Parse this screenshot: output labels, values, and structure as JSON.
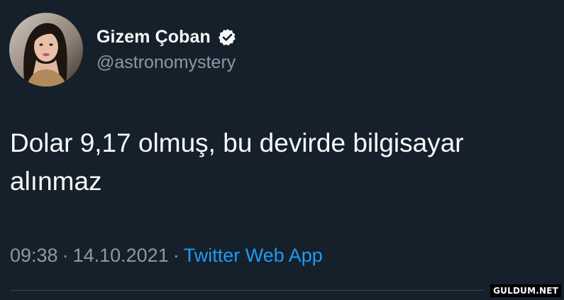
{
  "author": {
    "display_name": "Gizem Çoban",
    "handle": "@astronomystery",
    "verified_icon": "verified-badge-icon",
    "avatar_icon": "profile-photo"
  },
  "tweet": {
    "text": "Dolar 9,17 olmuş, bu devirde bilgisayar alınmaz"
  },
  "meta": {
    "time": "09:38",
    "separator": "·",
    "date": "14.10.2021",
    "source": "Twitter Web App"
  },
  "watermark": {
    "text": "GULDUM.NET"
  },
  "colors": {
    "background": "#15202b",
    "primary_text": "#f7f9f9",
    "secondary_text": "#8b98a5",
    "link": "#1d9bf0",
    "divider": "#38444d"
  }
}
